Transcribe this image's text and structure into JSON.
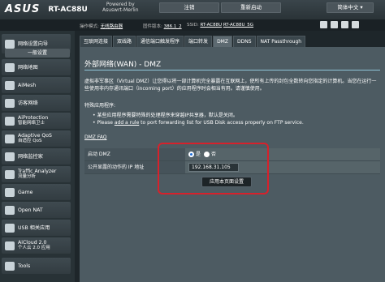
{
  "header": {
    "brand": "ASUS",
    "model": "RT-AC88U",
    "powered_by": "Powered by",
    "powered_name": "Asuswrt-Merlin",
    "logout": "注销",
    "reboot": "重新启动",
    "language": "简体中文"
  },
  "infobar": {
    "mode_label": "操作模式:",
    "mode_value": "无线路由器",
    "fw_label": "固件版本:",
    "fw_value": "386.1_2",
    "ssid_label": "SSID:",
    "ssid_1": "RT-AC88U",
    "ssid_2": "RT-AC88U_5G"
  },
  "sidebar": {
    "items_top": [
      {
        "label": "网络设置向导"
      }
    ],
    "section_general": "一般设置",
    "items": [
      {
        "label": "网络地图"
      },
      {
        "label": "AiMesh"
      },
      {
        "label": "访客网络"
      },
      {
        "label": "AiProtection",
        "sub": "智能网络卫士"
      },
      {
        "label": "Adaptive QoS",
        "sub": "自适应 QoS"
      },
      {
        "label": "网络监控家"
      },
      {
        "label": "Traffic Analyzer",
        "sub": "流量分析"
      },
      {
        "label": "Game"
      },
      {
        "label": "Open NAT"
      },
      {
        "label": "USB 相关应用"
      },
      {
        "label": "AiCloud 2.0",
        "sub": "个人云 2.0 应用"
      },
      {
        "label": "Tools"
      }
    ]
  },
  "tabs": [
    {
      "label": "互联网连接",
      "active": false
    },
    {
      "label": "双线路",
      "active": false
    },
    {
      "label": "通信端口触发程序",
      "active": false
    },
    {
      "label": "端口转发",
      "active": false
    },
    {
      "label": "DMZ",
      "active": true
    },
    {
      "label": "DDNS",
      "active": false
    },
    {
      "label": "NAT Passthrough",
      "active": false
    }
  ],
  "content": {
    "title": "外部网络(WAN) - DMZ",
    "desc_1": "虚拟非军事区（Virtual DMZ）让您得以将一部计算机完全暴露在互联网上，使所有上传的封包全数转向您指定的计算机。当您在运行一些使用非内存通讯端口（incoming port）的应用程序时会相当有用。请谨慎使用。",
    "special_title": "特殊应用程序:",
    "bullet_1": "某些应用程序需要特殊的处理程序来穿越IP共享器，默认是关闭。",
    "bullet_2_pre": "Please ",
    "bullet_2_link": "add a rule",
    "bullet_2_post": " to port forwarding list for USB Disk access properly on FTP service.",
    "faq": "DMZ FAQ",
    "enable_label": "启动 DMZ",
    "yes": "是",
    "no": "否",
    "ip_label": "公开显露的动作的 IP 地址",
    "ip_value": "192.168.31.105",
    "apply": "应用本页面设置"
  }
}
